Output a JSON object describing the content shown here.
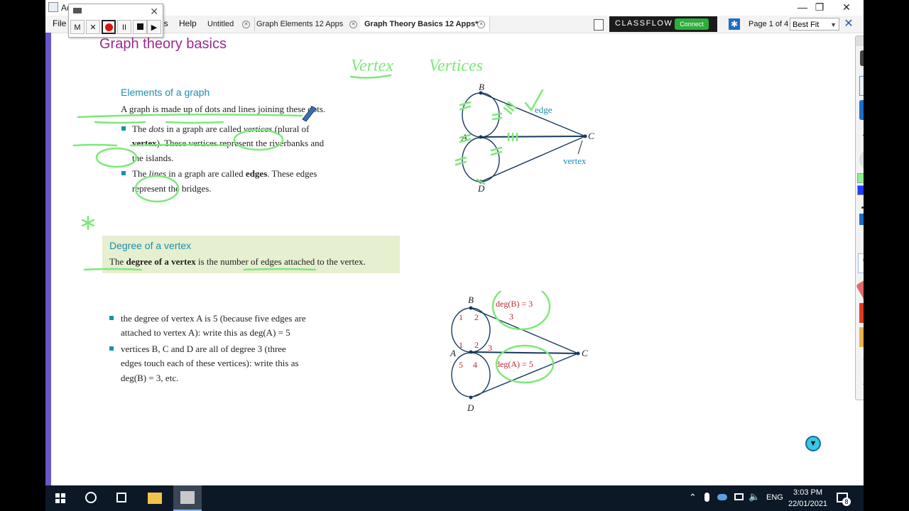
{
  "window": {
    "app_title": "Ac",
    "minimize": "—",
    "maximize": "❐",
    "close": "✕"
  },
  "menu": {
    "file": "File",
    "tools_fragment": "ls",
    "help": "Help"
  },
  "recorder": {
    "m": "M",
    "x": "✕",
    "pause": "II",
    "play": "▶",
    "close": "✕"
  },
  "tabs": [
    {
      "label": "Untitled"
    },
    {
      "label": "Graph Elements 12 Apps"
    },
    {
      "label": "Graph Theory Basics 12 Apps*"
    }
  ],
  "classflow": {
    "label": "CLASSFLOW",
    "connect": "Connect"
  },
  "page": {
    "info": "Page 1 of 4",
    "fit": "Best Fit"
  },
  "content": {
    "title": "Graph theory basics",
    "elements_heading": "Elements of a graph",
    "intro": "A graph is made up of dots and lines joining these dots.",
    "bullet1_l1_a": "The ",
    "bullet1_l1_i": "dots",
    "bullet1_l1_b": " in a graph are called ",
    "bullet1_l1_i2": "vertices",
    "bullet1_l1_c": " (plural of",
    "bullet1_l2_b": "vertex",
    "bullet1_l2_c": "). These vertices represent the riverbanks and",
    "bullet1_l3": "the islands.",
    "bullet2_l1_a": "The ",
    "bullet2_l1_i": "lines",
    "bullet2_l1_b": " in a graph are called ",
    "bullet2_l1_bold": "edges",
    "bullet2_l1_c": ". These edges",
    "bullet2_l2": "represent the bridges.",
    "degree_heading": "Degree of a vertex",
    "degree_def_a": "The ",
    "degree_def_b": "degree of a vertex",
    "degree_def_c": " is the number of edges attached to the vertex.",
    "deg_b1_l1": "the degree of vertex A is 5 (because five edges are",
    "deg_b1_l2": "attached to vertex A): write this as deg(A) = 5",
    "deg_b2_l1": "vertices B, C and D are all of degree 3 (three",
    "deg_b2_l2": "edges touch each of these vertices): write this as",
    "deg_b2_l3": "deg(B) = 3, etc."
  },
  "graph1": {
    "B": "B",
    "A": "A",
    "C": "C",
    "D": "D",
    "edge": "edge",
    "vertex": "vertex"
  },
  "graph2": {
    "B": "B",
    "A": "A",
    "C": "C",
    "D": "D",
    "degB": "deg(B) = 3",
    "degA": "deg(A) = 5",
    "n1": "1",
    "n2": "2",
    "n3": "3",
    "n4": "4",
    "n5": "5"
  },
  "handwriting": {
    "word1": "Vertex",
    "word2": "Vertices"
  },
  "taskbar": {
    "lang": "ENG",
    "time": "3:03 PM",
    "date": "22/01/2021",
    "notif": "8"
  },
  "colors": {
    "accent_purple": "#9a2b8c",
    "heading_blue": "#1a8fb0",
    "ink_green": "#7ee87a",
    "graph_navy": "#173a5e",
    "label_red": "#c0262d"
  }
}
